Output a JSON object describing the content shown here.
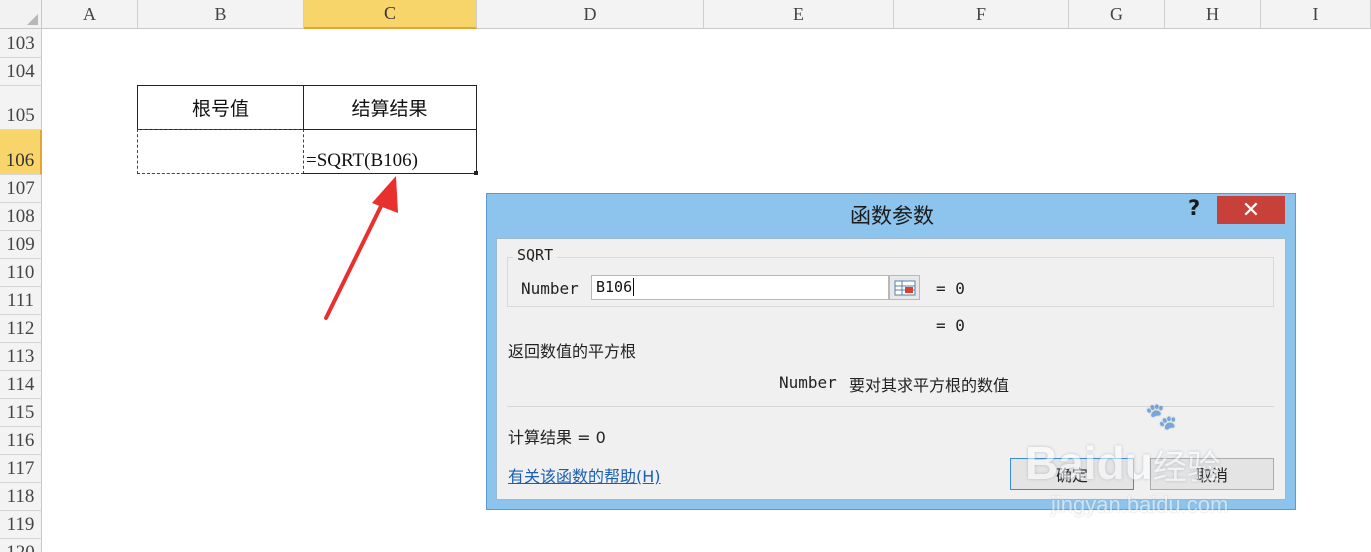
{
  "columns": [
    "A",
    "B",
    "C",
    "D",
    "E",
    "F",
    "G",
    "H",
    "I"
  ],
  "selected_column": "C",
  "rows": [
    "103",
    "104",
    "105",
    "106",
    "107",
    "108",
    "109",
    "110",
    "111",
    "112",
    "113",
    "114",
    "115",
    "116",
    "117",
    "118",
    "119",
    "120"
  ],
  "selected_row": "106",
  "cells": {
    "b105": "根号值",
    "c105": "结算结果",
    "b106": "",
    "c106": "=SQRT(B106)"
  },
  "dialog": {
    "title": "函数参数",
    "help_icon": "?",
    "close_icon": "✕",
    "function_name": "SQRT",
    "arg_label": "Number",
    "arg_value": "B106",
    "arg_result": "=  0",
    "func_result": "=  0",
    "description": "返回数值的平方根",
    "arg_desc_name": "Number",
    "arg_desc_text": "要对其求平方根的数值",
    "calc_result": "计算结果 =  0",
    "help_link": "有关该函数的帮助(H)",
    "ok_label": "确定",
    "cancel_label": "取消"
  },
  "watermark": {
    "brand": "Bai",
    "brand2": "du",
    "suffix": "经验",
    "url": "jingyan.baidu.com"
  },
  "colors": {
    "arrow": "#e8312e",
    "selected_header": "#f7d56a",
    "dialog_frame": "#8cc4ee",
    "close_button": "#c8403a"
  }
}
